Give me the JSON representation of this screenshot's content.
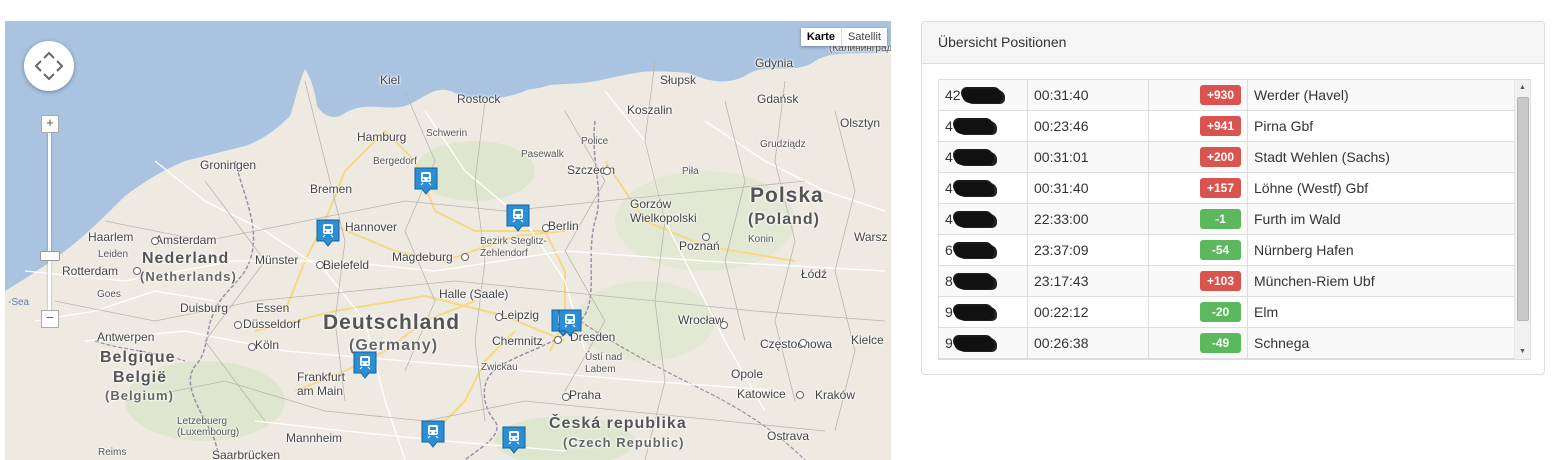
{
  "map": {
    "maptype": {
      "karte": "Karte",
      "satellit": "Satellit"
    },
    "zoom": {
      "plus": "+",
      "minus": "−"
    },
    "countries": [
      {
        "id": "deutschland",
        "text": "Deutschland"
      },
      {
        "id": "germany",
        "text": "(Germany)"
      },
      {
        "id": "polska",
        "text": "Polska"
      },
      {
        "id": "poland",
        "text": "(Poland)"
      },
      {
        "id": "nederland",
        "text": "Nederland"
      },
      {
        "id": "netherlands",
        "text": "(Netherlands)"
      },
      {
        "id": "belgique",
        "text": "Belgique"
      },
      {
        "id": "belgie",
        "text": "België"
      },
      {
        "id": "belgium",
        "text": "(Belgium)"
      },
      {
        "id": "cesko",
        "text": "Česká republika"
      },
      {
        "id": "czech",
        "text": "(Czech Republic)"
      }
    ],
    "cities": [
      "Gdynia",
      "(Калининград",
      "Kiel",
      "Rostock",
      "Słupsk",
      "Gdańsk",
      "Koszalin",
      "Olsztyn",
      "Hamburg",
      "Schwerin",
      "Bergedorf",
      "Pasewalk",
      "Police",
      "Grudziądz",
      "Groningen",
      "Szczecin",
      "Piła",
      "Bremen",
      "Gorzów Wielkopolski",
      "Hannover",
      "Berlin",
      "Bezirk Steglitz-Zehlendorf",
      "Haarlem",
      "Amsterdam",
      "Leiden",
      "Poznań",
      "Konin",
      "Warsz",
      "Rotterdam",
      "Münster",
      "Bielefeld",
      "Magdeburg",
      "Łódź",
      "Halle (Saale)",
      "Goes",
      "Duisburg",
      "Essen",
      "Düsseldorf",
      "Leipzig",
      "Dresden",
      "Wrocław",
      "Antwerpen",
      "Köln",
      "Chemnitz",
      "Częstochowa",
      "Kielce",
      "Ústí nad Labem",
      "Zwickau",
      "Opole",
      "Frankfurt am Main",
      "Praha",
      "Katowice",
      "Kraków",
      "Letzebuerg (Luxembourg)",
      "Mannheim",
      "Ostrava",
      "Reims",
      "Saarbrücken",
      "-Sea"
    ]
  },
  "panel": {
    "title": "Übersicht Positionen",
    "rows": [
      {
        "id": "42",
        "time": "00:31:40",
        "delay": "+930",
        "delay_color": "#d9534f",
        "station": "Werder (Havel)"
      },
      {
        "id": "4",
        "time": "00:23:46",
        "delay": "+941",
        "delay_color": "#d9534f",
        "station": "Pirna Gbf"
      },
      {
        "id": "4",
        "time": "00:31:01",
        "delay": "+200",
        "delay_color": "#d9534f",
        "station": "Stadt Wehlen (Sachs)"
      },
      {
        "id": "4",
        "time": "00:31:40",
        "delay": "+157",
        "delay_color": "#d9534f",
        "station": "Löhne (Westf) Gbf"
      },
      {
        "id": "4",
        "time": "22:33:00",
        "delay": "-1",
        "delay_color": "#5cb85c",
        "station": "Furth im Wald"
      },
      {
        "id": "6",
        "time": "23:37:09",
        "delay": "-54",
        "delay_color": "#5cb85c",
        "station": "Nürnberg Hafen"
      },
      {
        "id": "8",
        "time": "23:17:43",
        "delay": "+103",
        "delay_color": "#d9534f",
        "station": "München-Riem Ubf"
      },
      {
        "id": "9",
        "time": "00:22:12",
        "delay": "-20",
        "delay_color": "#5cb85c",
        "station": "Elm"
      },
      {
        "id": "9",
        "time": "00:26:38",
        "delay": "-49",
        "delay_color": "#5cb85c",
        "station": "Schnega"
      }
    ]
  }
}
